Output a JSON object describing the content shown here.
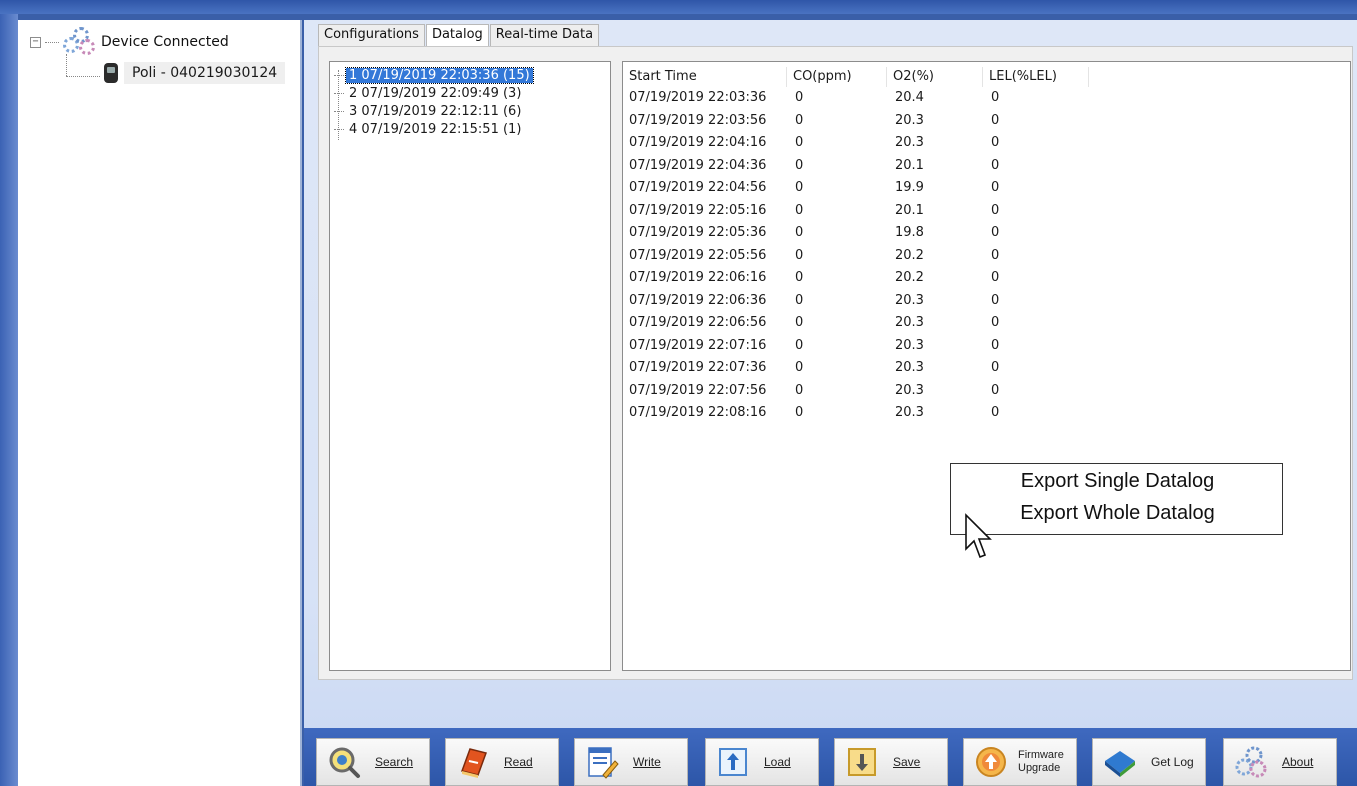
{
  "tree": {
    "root_label": "Device Connected",
    "expander_glyph": "−",
    "device_label": "Poli - 040219030124"
  },
  "tabs": [
    {
      "label": "Configurations",
      "active": false
    },
    {
      "label": "Datalog",
      "active": true
    },
    {
      "label": "Real-time Data",
      "active": false
    }
  ],
  "datalog_list": [
    {
      "label": "1 07/19/2019 22:03:36 (15)",
      "selected": true
    },
    {
      "label": "2 07/19/2019 22:09:49 (3)",
      "selected": false
    },
    {
      "label": "3 07/19/2019 22:12:11 (6)",
      "selected": false
    },
    {
      "label": "4 07/19/2019 22:15:51 (1)",
      "selected": false
    }
  ],
  "table": {
    "headers": [
      "Start Time",
      "CO(ppm)",
      "O2(%)",
      "LEL(%LEL)"
    ],
    "rows": [
      [
        "07/19/2019 22:03:36",
        "0",
        "20.4",
        "0"
      ],
      [
        "07/19/2019 22:03:56",
        "0",
        "20.3",
        "0"
      ],
      [
        "07/19/2019 22:04:16",
        "0",
        "20.3",
        "0"
      ],
      [
        "07/19/2019 22:04:36",
        "0",
        "20.1",
        "0"
      ],
      [
        "07/19/2019 22:04:56",
        "0",
        "19.9",
        "0"
      ],
      [
        "07/19/2019 22:05:16",
        "0",
        "20.1",
        "0"
      ],
      [
        "07/19/2019 22:05:36",
        "0",
        "19.8",
        "0"
      ],
      [
        "07/19/2019 22:05:56",
        "0",
        "20.2",
        "0"
      ],
      [
        "07/19/2019 22:06:16",
        "0",
        "20.2",
        "0"
      ],
      [
        "07/19/2019 22:06:36",
        "0",
        "20.3",
        "0"
      ],
      [
        "07/19/2019 22:06:56",
        "0",
        "20.3",
        "0"
      ],
      [
        "07/19/2019 22:07:16",
        "0",
        "20.3",
        "0"
      ],
      [
        "07/19/2019 22:07:36",
        "0",
        "20.3",
        "0"
      ],
      [
        "07/19/2019 22:07:56",
        "0",
        "20.3",
        "0"
      ],
      [
        "07/19/2019 22:08:16",
        "0",
        "20.3",
        "0"
      ]
    ]
  },
  "context_menu": {
    "items": [
      "Export Single Datalog",
      "Export Whole Datalog"
    ]
  },
  "toolbar": {
    "buttons": [
      {
        "label": "Search",
        "icon": "magnifier-icon"
      },
      {
        "label": "Read",
        "icon": "book-icon"
      },
      {
        "label": "Write",
        "icon": "pen-document-icon"
      },
      {
        "label": "Load",
        "icon": "upload-arrow-icon"
      },
      {
        "label": "Save",
        "icon": "download-arrow-icon"
      },
      {
        "label": "Firmware\nUpgrade",
        "icon": "upgrade-icon"
      },
      {
        "label": "Get Log",
        "icon": "diamond-icon"
      },
      {
        "label": "About",
        "icon": "gears-icon"
      }
    ]
  },
  "colors": {
    "frame_blue": "#3a5fa8",
    "selection_blue": "#3378d8",
    "panel_bg": "#dee7f7"
  }
}
